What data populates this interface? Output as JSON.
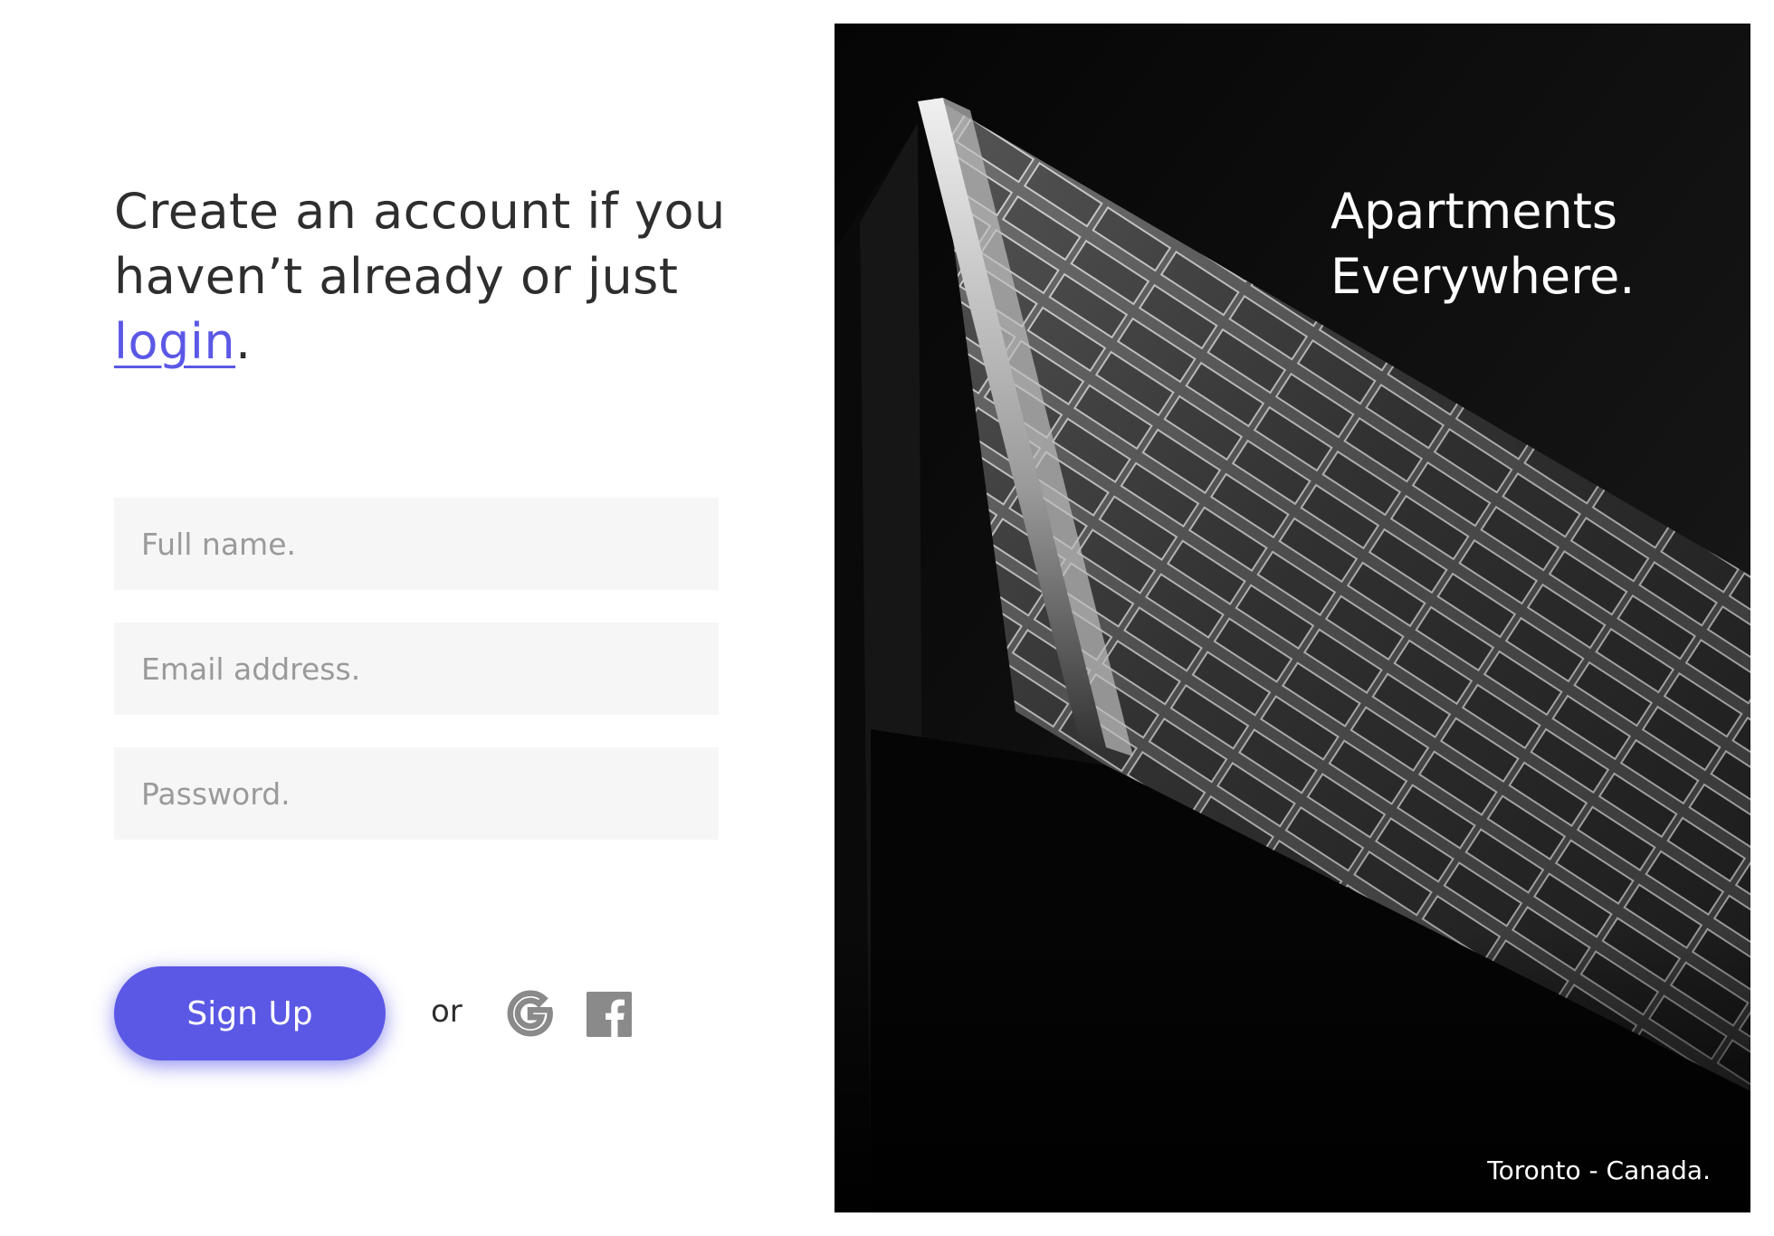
{
  "headline": {
    "text_before": "Create an account if you haven’t already or just ",
    "link_label": "login",
    "text_after": "."
  },
  "form": {
    "full_name": {
      "placeholder": "Full name.",
      "value": ""
    },
    "email": {
      "placeholder": "Email address.",
      "value": ""
    },
    "password": {
      "placeholder": "Password.",
      "value": ""
    }
  },
  "actions": {
    "signup_label": "Sign Up",
    "or_label": "or"
  },
  "social": [
    {
      "icon": "google-icon",
      "color": "#8a8a8a"
    },
    {
      "icon": "facebook-icon",
      "color": "#8a8a8a"
    }
  ],
  "hero": {
    "title_line1": "Apartments",
    "title_line2": "Everywhere.",
    "caption": "Toronto - Canada."
  },
  "colors": {
    "accent": "#5b58e6",
    "field_bg": "#f6f6f6",
    "text": "#2e2e2e"
  }
}
